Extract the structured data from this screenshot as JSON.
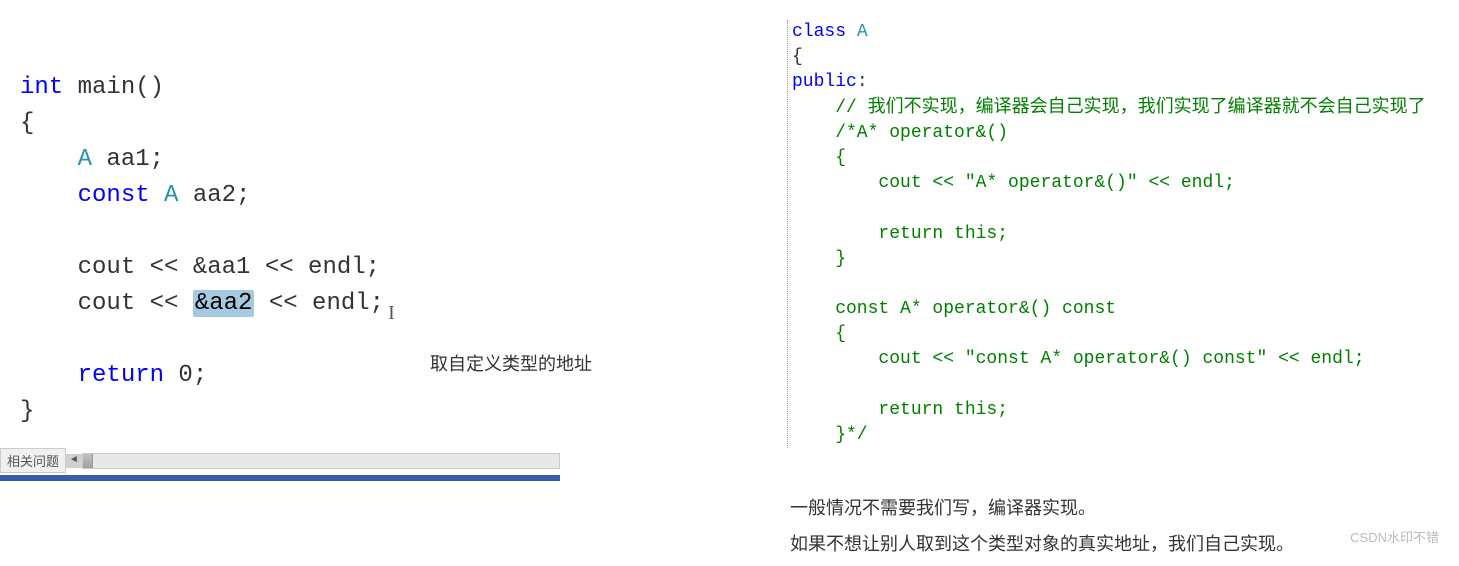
{
  "left_code": {
    "l1": {
      "kw": "int",
      "name": " main()"
    },
    "l2": "{",
    "l3": {
      "indent": "    ",
      "type": "A",
      "rest": " aa1;"
    },
    "l4": {
      "indent": "    ",
      "kw": "const",
      "type": " A",
      "rest": " aa2;"
    },
    "l5": "",
    "l6": "    cout << &aa1 << endl;",
    "l7": {
      "pre": "    cout << ",
      "sel": "&aa2",
      "post": " << endl;"
    },
    "l8": "",
    "l9": {
      "indent": "    ",
      "kw": "return",
      "rest": " 0;"
    },
    "l10": "}"
  },
  "mid_label": "取自定义类型的地址",
  "bottom_label": "相关问题",
  "right_code": {
    "l1": {
      "kw": "class",
      "cls": " A"
    },
    "l2": "{",
    "l3": {
      "kw": "public",
      "colon": ":"
    },
    "l4": "    // 我们不实现，编译器会自己实现，我们实现了编译器就不会自己实现了",
    "l5": "    /*A* operator&()",
    "l6": "    {",
    "l7": "        cout << \"A* operator&()\" << endl;",
    "l8": "",
    "l9": "        return this;",
    "l10": "    }",
    "l11": "",
    "l12": "    const A* operator&() const",
    "l13": "    {",
    "l14": "        cout << \"const A* operator&() const\" << endl;",
    "l15": "",
    "l16": "        return this;",
    "l17": "    }*/"
  },
  "explain": {
    "line1": "一般情况不需要我们写，编译器实现。",
    "line2": "如果不想让别人取到这个类型对象的真实地址，我们自己实现。"
  },
  "watermark": "CSDN水印不错"
}
